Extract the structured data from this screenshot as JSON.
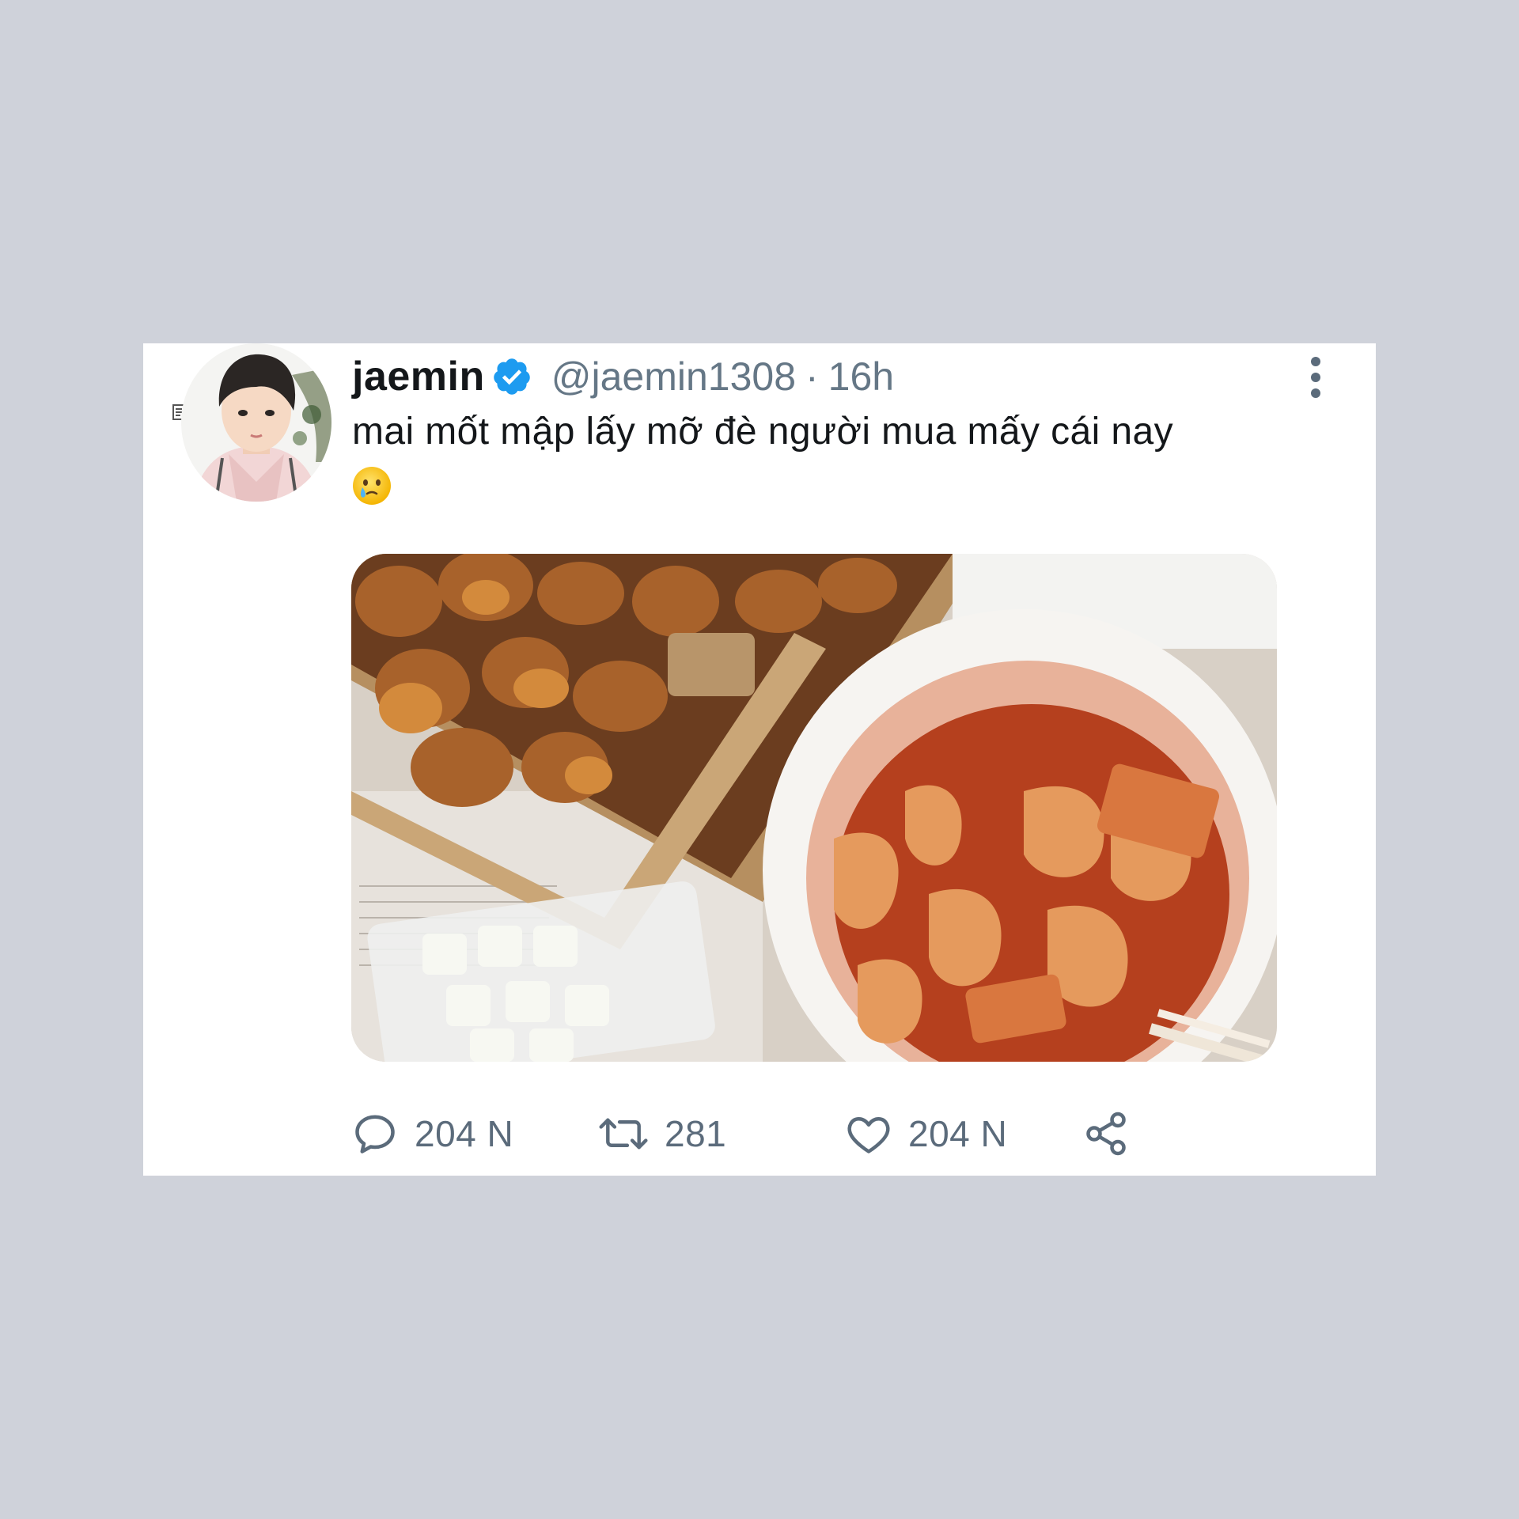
{
  "tweet": {
    "display_name": "jaemin",
    "verified": true,
    "handle": "@jaemin1308",
    "separator": "·",
    "time": "16h",
    "text": "mai mốt mập lấy mỡ đè người mua mấy cái nay",
    "emoji": "face-holding-back-tears"
  },
  "actions": {
    "reply_count": "204 N",
    "retweet_count": "281",
    "like_count": "204 N"
  },
  "icons": {
    "more": "more-vertical-icon",
    "verified": "verified-badge-icon",
    "reply": "reply-icon",
    "retweet": "retweet-icon",
    "like": "heart-icon",
    "share": "share-icon"
  },
  "colors": {
    "background": "#cfd2da",
    "card": "#ffffff",
    "verified_blue": "#1d9bf0",
    "text": "#14171a",
    "secondary_text": "#657786"
  }
}
